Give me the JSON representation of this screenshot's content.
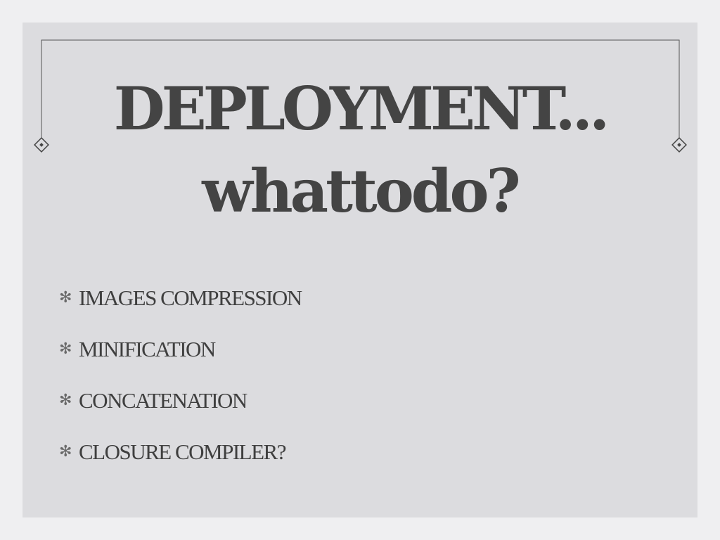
{
  "slide": {
    "title_line1": "DEPLOYMENT...",
    "title_line2": "whattodo?",
    "bullet_icon": "✻",
    "bullets": [
      "IMAGES COMPRESSION",
      "MINIFICATION",
      "CONCATENATION",
      "CLOSURE COMPILER?"
    ]
  }
}
